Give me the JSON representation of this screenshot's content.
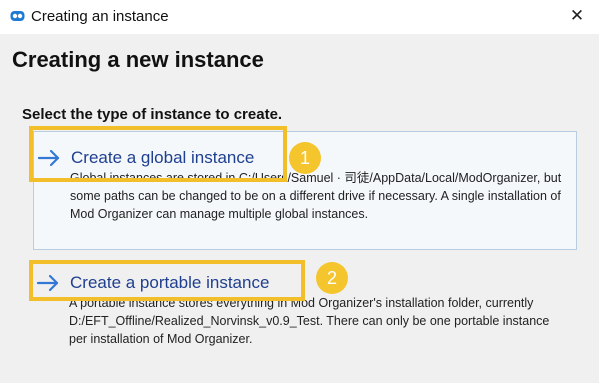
{
  "window": {
    "title": "Creating an instance",
    "close_symbol": "✕"
  },
  "page": {
    "title": "Creating a new instance",
    "instruction": "Select the type of instance to create."
  },
  "options": [
    {
      "title": "Create a global instance",
      "description": "Global instances are stored in C:/Users/Samuel · 司徒/AppData/Local/ModOrganizer, but some paths can be changed to be on a different drive if necessary. A single installation of Mod Organizer can manage multiple global instances.",
      "icon": "arrow-right-icon",
      "annotation_number": "1"
    },
    {
      "title": "Create a portable instance",
      "description": "A portable instance stores everything in Mod Organizer's installation folder, currently D:/EFT_Offline/Realized_Norvinsk_v0.9_Test. There can only be one portable instance per installation of Mod Organizer.",
      "icon": "arrow-right-icon",
      "annotation_number": "2"
    }
  ],
  "colors": {
    "window_background": "#f0f0f0",
    "title_bar": "#ffffff",
    "option_title": "#1f3f8f",
    "arrow": "#3478d6",
    "highlight": "#f2bf2a",
    "selected_option_background": "#f4f8fb",
    "selected_option_border": "#b8cee0"
  },
  "icons": {
    "window": "mod-organizer-icon",
    "close": "close-icon",
    "option_arrow": "arrow-right-icon"
  }
}
